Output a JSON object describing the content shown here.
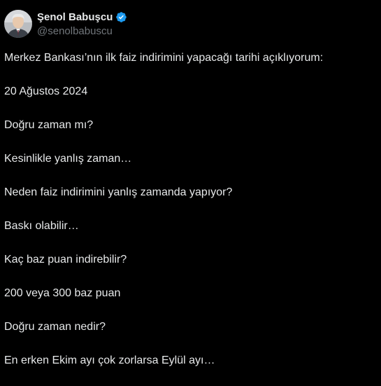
{
  "author": {
    "display_name": "Şenol Babuşcu",
    "handle": "@senolbabuscu",
    "verified": true,
    "verified_color": "#1d9bf0",
    "avatar_icon": "profile-photo"
  },
  "tweet": {
    "lines": [
      "Merkez Bankası’nın ilk faiz indirimini yapacağı tarihi açıklıyorum:",
      "20 Ağustos 2024",
      "Doğru zaman mı?",
      "Kesinlikle yanlış zaman…",
      "Neden faiz indirimini yanlış zamanda yapıyor?",
      "Baskı olabilir…",
      "Kaç baz puan indirebilir?",
      "200 veya 300 baz puan",
      "Doğru zaman nedir?",
      "En erken Ekim ayı çok zorlarsa Eylül ayı…"
    ]
  },
  "colors": {
    "background": "#000000",
    "text": "#e7e9ea",
    "secondary_text": "#71767b"
  }
}
